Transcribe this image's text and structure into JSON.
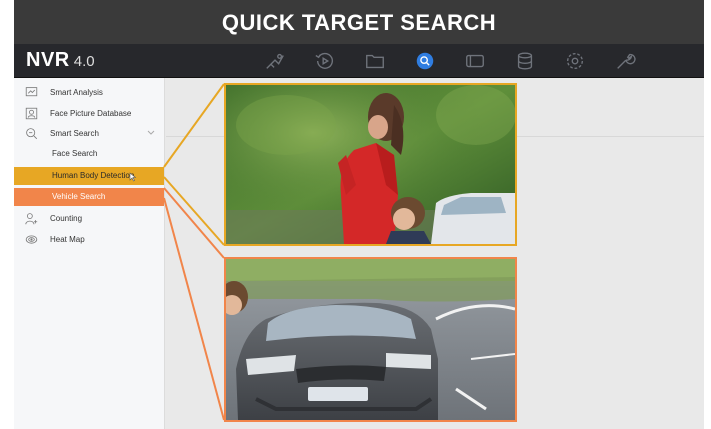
{
  "banner": {
    "title": "QUICK TARGET SEARCH"
  },
  "app": {
    "logo_main": "NVR",
    "logo_version": "4.0"
  },
  "toolbar": {
    "icons": [
      "live-view-icon",
      "playback-icon",
      "file-folder-icon",
      "smart-search-icon",
      "device-icon",
      "storage-icon",
      "settings-icon",
      "maintenance-icon"
    ],
    "active_icon": "smart-search-icon"
  },
  "sidebar": {
    "items": [
      {
        "label": "Smart Analysis",
        "icon": "chart-monitor-icon"
      },
      {
        "label": "Face Picture Database",
        "icon": "face-database-icon"
      },
      {
        "label": "Smart Search",
        "icon": "magnifier-icon",
        "expanded": true
      },
      {
        "label": "Counting",
        "icon": "person-count-icon"
      },
      {
        "label": "Heat Map",
        "icon": "heat-map-icon"
      }
    ],
    "sub_items": [
      {
        "label": "Face Search",
        "state": "normal"
      },
      {
        "label": "Human Body Detection",
        "state": "hover"
      },
      {
        "label": "Vehicle Search",
        "state": "selected"
      }
    ]
  },
  "colors": {
    "banner_bg": "#3a3a3a",
    "topbar_bg": "#27282c",
    "accent_blue": "#2f7de1",
    "human_highlight": "#e7a724",
    "vehicle_highlight": "#f1854a"
  }
}
